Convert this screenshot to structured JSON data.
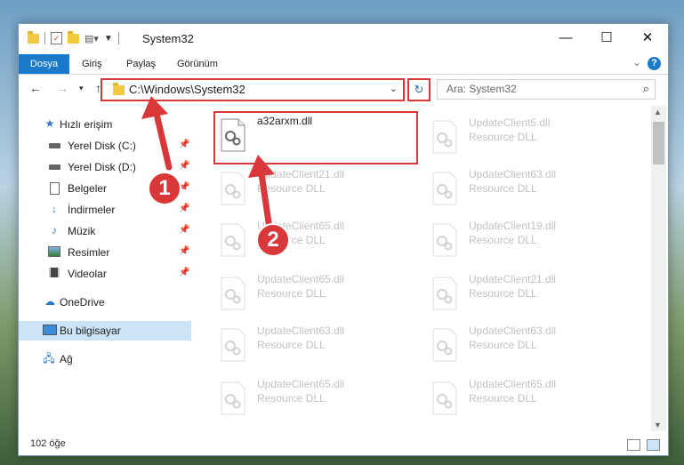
{
  "window": {
    "title": "System32"
  },
  "ribbon": {
    "tabs": [
      "Dosya",
      "Giriş",
      "Paylaş",
      "Görünüm"
    ],
    "help": "?"
  },
  "address": {
    "path": "C:\\Windows\\System32"
  },
  "search": {
    "placeholder": "Ara: System32"
  },
  "sidebar": {
    "quick_access": "Hızlı erişim",
    "items": [
      {
        "label": "Yerel Disk (C:)",
        "icon": "drive-icon",
        "pinned": true
      },
      {
        "label": "Yerel Disk (D:)",
        "icon": "drive-icon",
        "pinned": true
      },
      {
        "label": "Belgeler",
        "icon": "documents-icon",
        "pinned": true
      },
      {
        "label": "İndirmeler",
        "icon": "downloads-icon",
        "pinned": true
      },
      {
        "label": "Müzik",
        "icon": "music-icon",
        "pinned": true
      },
      {
        "label": "Resimler",
        "icon": "pictures-icon",
        "pinned": true
      },
      {
        "label": "Videolar",
        "icon": "videos-icon",
        "pinned": true
      }
    ],
    "onedrive": "OneDrive",
    "this_pc": "Bu bilgisayar",
    "network": "Ağ"
  },
  "files": [
    {
      "name": "a32arxm.dll",
      "type": "",
      "active": true
    },
    {
      "name": "UpdateClient5.dll",
      "type": "Resource DLL"
    },
    {
      "name": "UpdateClient21.dll",
      "type": "Resource DLL"
    },
    {
      "name": "UpdateClient63.dll",
      "type": "Resource DLL"
    },
    {
      "name": "UpdateClient65.dll",
      "type": "Resource DLL"
    },
    {
      "name": "UpdateClient19.dll",
      "type": "Resource DLL"
    },
    {
      "name": "UpdateClient65.dll",
      "type": "Resource DLL"
    },
    {
      "name": "UpdateClient21.dll",
      "type": "Resource DLL"
    },
    {
      "name": "UpdateClient63.dll",
      "type": "Resource DLL"
    },
    {
      "name": "UpdateClient63.dll",
      "type": "Resource DLL"
    },
    {
      "name": "UpdateClient65.dll",
      "type": "Resource DLL"
    },
    {
      "name": "UpdateClient65.dll",
      "type": "Resource DLL"
    }
  ],
  "status": {
    "count": "102 öğe"
  },
  "callouts": [
    "1",
    "2"
  ],
  "colors": {
    "accent": "#1979ca",
    "highlight": "#d9383a",
    "selected": "#cce4f7"
  }
}
